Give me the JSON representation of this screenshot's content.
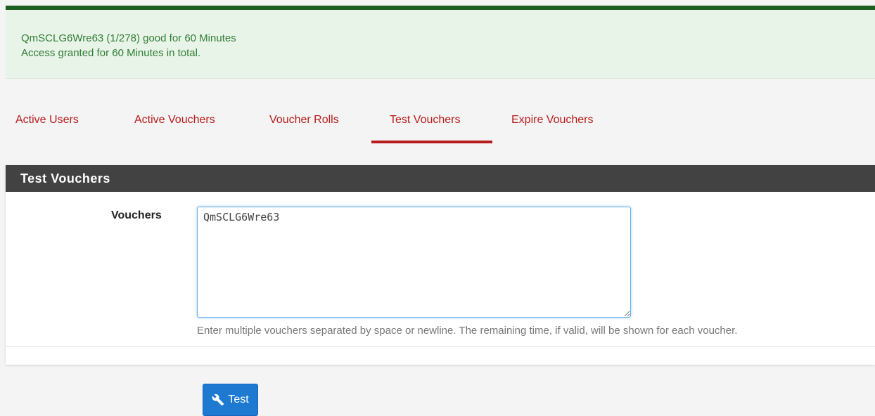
{
  "alert": {
    "line1": "QmSCLG6Wre63 (1/278) good for 60 Minutes",
    "line2": "Access granted for 60 Minutes in total."
  },
  "tabs": [
    {
      "label": "Active Users"
    },
    {
      "label": "Active Vouchers"
    },
    {
      "label": "Voucher Rolls"
    },
    {
      "label": "Test Vouchers",
      "active": true
    },
    {
      "label": "Expire Vouchers"
    }
  ],
  "panel": {
    "title": "Test Vouchers",
    "vouchers_label": "Vouchers",
    "vouchers_value": "QmSCLG6Wre63",
    "help": "Enter multiple vouchers separated by space or newline. The remaining time, if valid, will be shown for each voucher."
  },
  "actions": {
    "test_label": "Test",
    "test_icon": "wrench-icon"
  },
  "colors": {
    "success_bg": "#e9f4e9",
    "success_text": "#2e7d32",
    "success_border": "#1b5e20",
    "tab_accent": "#b71c1c",
    "panel_heading_bg": "#424242",
    "button_primary": "#1e7ad1"
  }
}
